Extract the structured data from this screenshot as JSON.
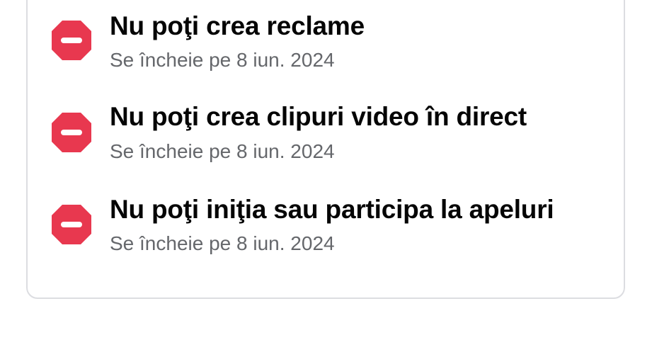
{
  "restrictions": [
    {
      "title": "Nu poţi crea reclame",
      "subtitle": "Se încheie pe 8 iun. 2024",
      "icon": "stop-icon"
    },
    {
      "title": "Nu poţi crea clipuri video în direct",
      "subtitle": "Se încheie pe 8 iun. 2024",
      "icon": "stop-icon"
    },
    {
      "title": "Nu poţi iniţia sau participa la apeluri",
      "subtitle": "Se încheie pe 8 iun. 2024",
      "icon": "stop-icon"
    }
  ],
  "colors": {
    "stop_icon": "#e8384f",
    "title_text": "#050505",
    "subtitle_text": "#65676b",
    "card_border": "#dcdde1"
  }
}
